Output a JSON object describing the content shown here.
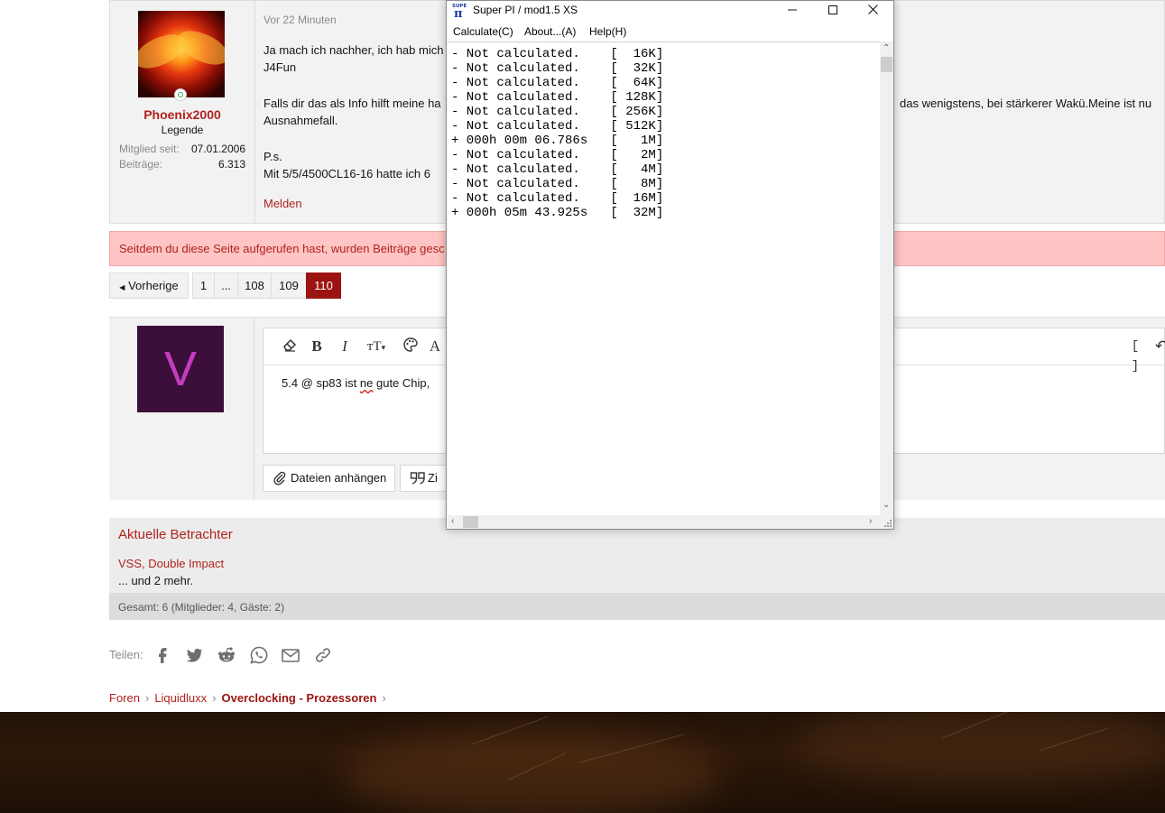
{
  "post": {
    "username": "Phoenix2000",
    "user_title": "Legende",
    "joined_label": "Mitglied seit:",
    "joined_value": "07.01.2006",
    "posts_label": "Beiträge:",
    "posts_value": "6.313",
    "time": "Vor 22 Minuten",
    "line1": "Ja mach ich nachher, ich hab mich",
    "line2": "J4Fun",
    "line3": "Falls dir das als Info hilft meine ha",
    "line3_right": "das wenigstens, bei stärkerer Wakü.Meine ist nu",
    "line4": "Ausnahmefall.",
    "line5": "P.s.",
    "line6": "Mit 5/5/4500CL16-16 hatte ich 6",
    "report": "Melden"
  },
  "notice": "Seitdem du diese Seite aufgerufen hast, wurden Beiträge gesc",
  "pagination": {
    "prev": "Vorherige",
    "pages": [
      "1",
      "...",
      "108",
      "109",
      "110"
    ],
    "current": "110"
  },
  "reply": {
    "avatar_letter": "V",
    "editor_text_before": "5.4 @ sp83 ist ",
    "editor_text_misspelled": "ne",
    "editor_text_after": " gute Chip,",
    "attach_button": "Dateien anhängen",
    "quote_button": "Zi",
    "toolbar_icons": [
      "eraser-icon",
      "bold-icon",
      "italic-icon",
      "font-size-icon",
      "palette-icon",
      "font-icon",
      "brackets-icon",
      "undo-icon"
    ]
  },
  "viewers": {
    "title": "Aktuelle Betrachter",
    "list": "VSS, Double Impact",
    "more": "... und 2 mehr.",
    "total": "Gesamt: 6 (Mitglieder: 4, Gäste: 2)"
  },
  "share": {
    "label": "Teilen:",
    "icons": [
      "facebook-icon",
      "twitter-icon",
      "reddit-icon",
      "whatsapp-icon",
      "email-icon",
      "link-icon"
    ]
  },
  "breadcrumb": {
    "items": [
      "Foren",
      "Liquidluxx",
      "Overclocking - Prozessoren"
    ]
  },
  "superpi": {
    "title": "Super PI / mod1.5 XS",
    "icon_text": "SUPER π",
    "menus": [
      "Calculate(C)",
      "About...(A)",
      "Help(H)"
    ],
    "output_lines": [
      "- Not calculated.    [  16K]",
      "- Not calculated.    [  32K]",
      "- Not calculated.    [  64K]",
      "- Not calculated.    [ 128K]",
      "- Not calculated.    [ 256K]",
      "- Not calculated.    [ 512K]",
      "+ 000h 00m 06.786s   [   1M]",
      "- Not calculated.    [   2M]",
      "- Not calculated.    [   4M]",
      "- Not calculated.    [   8M]",
      "- Not calculated.    [  16M]",
      "+ 000h 05m 43.925s   [  32M]"
    ]
  }
}
